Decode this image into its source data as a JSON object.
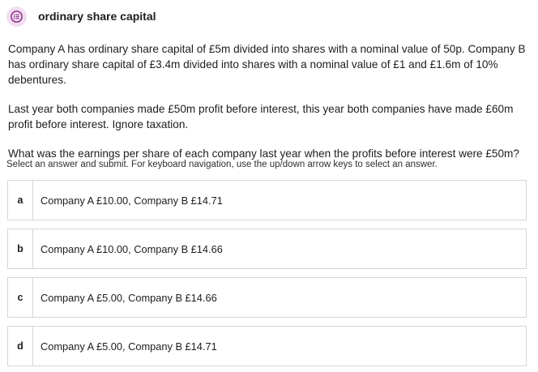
{
  "header": {
    "icon": "question-list-icon",
    "title": "ordinary share capital",
    "accent_color": "#8b2f8b",
    "badge_color": "#f2ddf2"
  },
  "question": {
    "paragraph_1": "Company A has ordinary share capital of £5m divided into shares with a nominal value of 50p. Company B has ordinary share capital of £3.4m divided into shares with a nominal value of £1 and £1.6m of 10% debentures.",
    "paragraph_2": "Last year both companies made £50m profit before interest, this year both companies have made £60m profit before interest. Ignore taxation.",
    "paragraph_3": "What was the earnings per share of each company last year when the profits before interest were £50m?"
  },
  "instructions": "Select an answer and submit. For keyboard navigation, use the up/down arrow keys to select an answer.",
  "options": [
    {
      "letter": "a",
      "text": "Company A £10.00, Company B £14.71"
    },
    {
      "letter": "b",
      "text": "Company A £10.00, Company B £14.66"
    },
    {
      "letter": "c",
      "text": "Company A £5.00, Company B £14.66"
    },
    {
      "letter": "d",
      "text": "Company A £5.00, Company B £14.71"
    }
  ]
}
